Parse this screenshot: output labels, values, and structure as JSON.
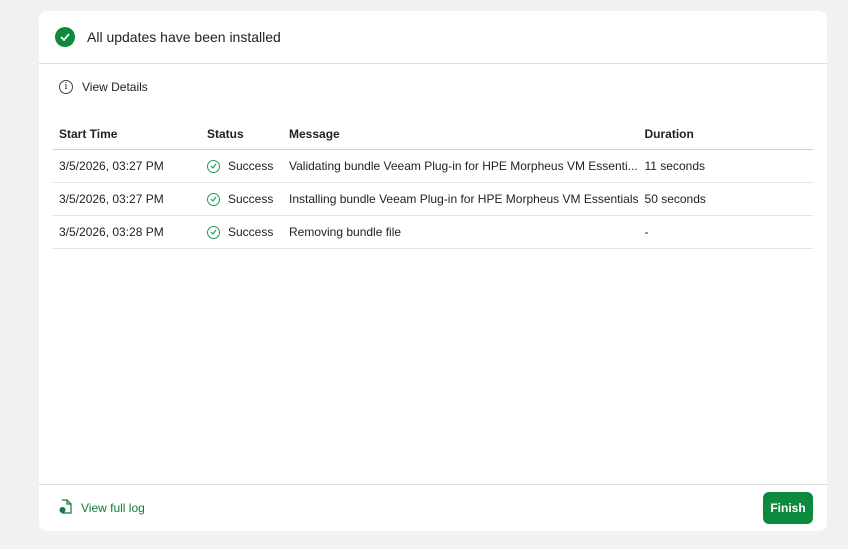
{
  "header": {
    "title": "All updates have been installed"
  },
  "details": {
    "label": "View Details"
  },
  "table": {
    "columns": [
      "Start Time",
      "Status",
      "Message",
      "Duration"
    ],
    "rows": [
      {
        "start": "3/5/2026, 03:27 PM",
        "status": "Success",
        "message": "Validating bundle Veeam Plug-in for HPE Morpheus VM Essenti...",
        "duration": "11 seconds"
      },
      {
        "start": "3/5/2026, 03:27 PM",
        "status": "Success",
        "message": "Installing bundle Veeam Plug-in for HPE Morpheus VM Essentials",
        "duration": "50 seconds"
      },
      {
        "start": "3/5/2026, 03:28 PM",
        "status": "Success",
        "message": "Removing bundle file",
        "duration": "-"
      }
    ]
  },
  "footer": {
    "log_label": "View full log",
    "finish_label": "Finish"
  },
  "colors": {
    "accent": "#0e8a3e"
  }
}
